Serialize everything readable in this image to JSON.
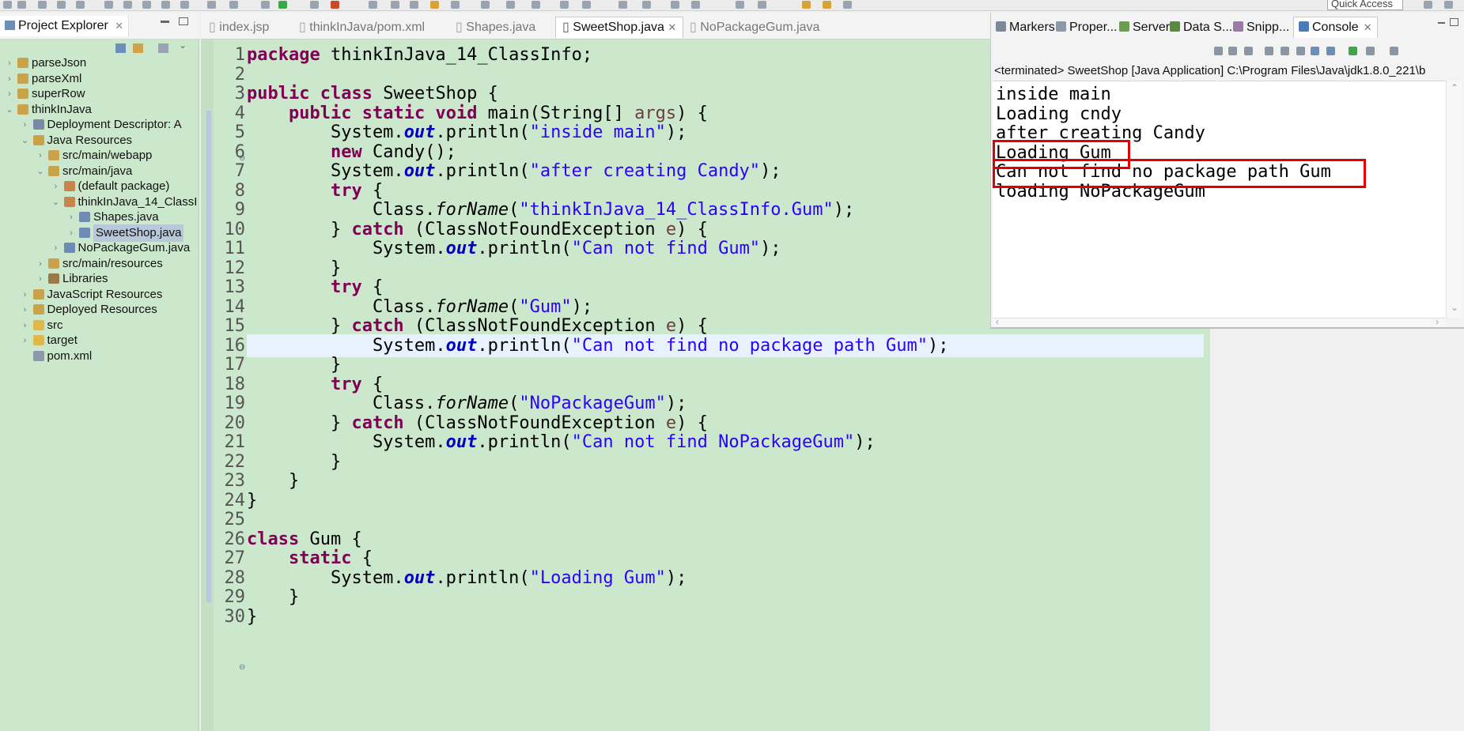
{
  "toolbar": {
    "quick_access": "Quick Access"
  },
  "explorer": {
    "tab_label": "Project Explorer",
    "items": [
      {
        "label": "parseJson",
        "arrow": "›",
        "icon": "project-folder-icon"
      },
      {
        "label": "parseXml",
        "arrow": "›",
        "icon": "project-folder-icon"
      },
      {
        "label": "superRow",
        "arrow": "›",
        "icon": "project-folder-icon"
      },
      {
        "label": "thinkInJava",
        "arrow": "⌄",
        "icon": "project-folder-icon"
      },
      {
        "label": "Deployment Descriptor: A",
        "arrow": "›",
        "icon": "deployment-descriptor-icon"
      },
      {
        "label": "Java Resources",
        "arrow": "⌄",
        "icon": "java-resources-icon"
      },
      {
        "label": "src/main/webapp",
        "arrow": "›",
        "icon": "source-folder-icon"
      },
      {
        "label": "src/main/java",
        "arrow": "⌄",
        "icon": "source-folder-icon"
      },
      {
        "label": "(default package)",
        "arrow": "›",
        "icon": "package-icon"
      },
      {
        "label": "thinkInJava_14_ClassI",
        "arrow": "⌄",
        "icon": "package-icon"
      },
      {
        "label": "Shapes.java",
        "arrow": "›",
        "icon": "java-file-icon"
      },
      {
        "label": "SweetShop.java",
        "arrow": "›",
        "icon": "java-file-icon"
      },
      {
        "label": "NoPackageGum.java",
        "arrow": "›",
        "icon": "java-file-icon"
      },
      {
        "label": "src/main/resources",
        "arrow": "›",
        "icon": "source-folder-icon"
      },
      {
        "label": "Libraries",
        "arrow": "›",
        "icon": "libraries-icon"
      },
      {
        "label": "JavaScript Resources",
        "arrow": "›",
        "icon": "javascript-resources-icon"
      },
      {
        "label": "Deployed Resources",
        "arrow": "›",
        "icon": "deployed-resources-icon"
      },
      {
        "label": "src",
        "arrow": "›",
        "icon": "folder-icon"
      },
      {
        "label": "target",
        "arrow": "›",
        "icon": "folder-icon"
      },
      {
        "label": "pom.xml",
        "arrow": "",
        "icon": "xml-file-icon"
      }
    ]
  },
  "editor": {
    "tabs": [
      "index.jsp",
      "thinkInJava/pom.xml",
      "Shapes.java",
      "SweetShop.java",
      "NoPackageGum.java"
    ],
    "active_tab": "SweetShop.java",
    "current_line": 16,
    "line_numbers": [
      "1",
      "2",
      "3",
      "4",
      "5",
      "6",
      "7",
      "8",
      "9",
      "10",
      "11",
      "12",
      "13",
      "14",
      "15",
      "16",
      "17",
      "18",
      "19",
      "20",
      "21",
      "22",
      "23",
      "24",
      "25",
      "26",
      "27",
      "28",
      "29",
      "30"
    ],
    "lines": [
      [
        [
          "kw",
          "package"
        ],
        [
          "p",
          " thinkInJava_14_ClassInfo;"
        ]
      ],
      [],
      [
        [
          "kw",
          "public"
        ],
        [
          "p",
          " "
        ],
        [
          "kw",
          "class"
        ],
        [
          "p",
          " SweetShop {"
        ]
      ],
      [
        [
          "p",
          "    "
        ],
        [
          "kw",
          "public"
        ],
        [
          "p",
          " "
        ],
        [
          "kw",
          "static"
        ],
        [
          "p",
          " "
        ],
        [
          "kw",
          "void"
        ],
        [
          "p",
          " main(String[] "
        ],
        [
          "var",
          "args"
        ],
        [
          "p",
          ") {"
        ]
      ],
      [
        [
          "p",
          "        System."
        ],
        [
          "fld",
          "out"
        ],
        [
          "p",
          ".println("
        ],
        [
          "str",
          "\"inside main\""
        ],
        [
          "p",
          ");"
        ]
      ],
      [
        [
          "p",
          "        "
        ],
        [
          "kw",
          "new"
        ],
        [
          "p",
          " Candy();"
        ]
      ],
      [
        [
          "p",
          "        System."
        ],
        [
          "fld",
          "out"
        ],
        [
          "p",
          ".println("
        ],
        [
          "str",
          "\"after creating Candy\""
        ],
        [
          "p",
          ");"
        ]
      ],
      [
        [
          "p",
          "        "
        ],
        [
          "kw",
          "try"
        ],
        [
          "p",
          " {"
        ]
      ],
      [
        [
          "p",
          "            Class."
        ],
        [
          "sm",
          "forName"
        ],
        [
          "p",
          "("
        ],
        [
          "str",
          "\"thinkInJava_14_ClassInfo.Gum\""
        ],
        [
          "p",
          ");"
        ]
      ],
      [
        [
          "p",
          "        } "
        ],
        [
          "kw",
          "catch"
        ],
        [
          "p",
          " (ClassNotFoundException "
        ],
        [
          "var",
          "e"
        ],
        [
          "p",
          ") {"
        ]
      ],
      [
        [
          "p",
          "            System."
        ],
        [
          "fld",
          "out"
        ],
        [
          "p",
          ".println("
        ],
        [
          "str",
          "\"Can not find Gum\""
        ],
        [
          "p",
          ");"
        ]
      ],
      [
        [
          "p",
          "        }"
        ]
      ],
      [
        [
          "p",
          "        "
        ],
        [
          "kw",
          "try"
        ],
        [
          "p",
          " {"
        ]
      ],
      [
        [
          "p",
          "            Class."
        ],
        [
          "sm",
          "forName"
        ],
        [
          "p",
          "("
        ],
        [
          "str",
          "\"Gum\""
        ],
        [
          "p",
          ");"
        ]
      ],
      [
        [
          "p",
          "        } "
        ],
        [
          "kw",
          "catch"
        ],
        [
          "p",
          " (ClassNotFoundException "
        ],
        [
          "var",
          "e"
        ],
        [
          "p",
          ") {"
        ]
      ],
      [
        [
          "p",
          "            System."
        ],
        [
          "fld",
          "out"
        ],
        [
          "p",
          ".println("
        ],
        [
          "str",
          "\"Can not find no package path Gum\""
        ],
        [
          "p",
          ");"
        ]
      ],
      [
        [
          "p",
          "        }"
        ]
      ],
      [
        [
          "p",
          "        "
        ],
        [
          "kw",
          "try"
        ],
        [
          "p",
          " {"
        ]
      ],
      [
        [
          "p",
          "            Class."
        ],
        [
          "sm",
          "forName"
        ],
        [
          "p",
          "("
        ],
        [
          "str",
          "\"NoPackageGum\""
        ],
        [
          "p",
          ");"
        ]
      ],
      [
        [
          "p",
          "        } "
        ],
        [
          "kw",
          "catch"
        ],
        [
          "p",
          " (ClassNotFoundException "
        ],
        [
          "var",
          "e"
        ],
        [
          "p",
          ") {"
        ]
      ],
      [
        [
          "p",
          "            System."
        ],
        [
          "fld",
          "out"
        ],
        [
          "p",
          ".println("
        ],
        [
          "str",
          "\"Can not find NoPackageGum\""
        ],
        [
          "p",
          ");"
        ]
      ],
      [
        [
          "p",
          "        }"
        ]
      ],
      [
        [
          "p",
          "    }"
        ]
      ],
      [
        [
          "p",
          "}"
        ]
      ],
      [],
      [
        [
          "kw",
          "class"
        ],
        [
          "p",
          " Gum {"
        ]
      ],
      [
        [
          "p",
          "    "
        ],
        [
          "kw",
          "static"
        ],
        [
          "p",
          " {"
        ]
      ],
      [
        [
          "p",
          "        System."
        ],
        [
          "fld",
          "out"
        ],
        [
          "p",
          ".println("
        ],
        [
          "str",
          "\"Loading Gum\""
        ],
        [
          "p",
          ");"
        ]
      ],
      [
        [
          "p",
          "    }"
        ]
      ],
      [
        [
          "p",
          "}"
        ]
      ]
    ]
  },
  "console": {
    "tabs": [
      {
        "label": "Markers",
        "icon": "markers-icon"
      },
      {
        "label": "Proper...",
        "icon": "properties-icon"
      },
      {
        "label": "Servers",
        "icon": "servers-icon"
      },
      {
        "label": "Data S...",
        "icon": "data-source-icon"
      },
      {
        "label": "Snipp...",
        "icon": "snippets-icon"
      },
      {
        "label": "Console",
        "icon": "console-icon"
      }
    ],
    "active_tab": "Console",
    "status": "<terminated> SweetShop [Java Application] C:\\Program Files\\Java\\jdk1.8.0_221\\b",
    "output": [
      "inside main",
      "Loading cndy",
      "after creating Candy",
      "Loading Gum",
      "Can not find no package path Gum",
      "loading NoPackageGum"
    ],
    "highlight_color": "#e00000"
  }
}
